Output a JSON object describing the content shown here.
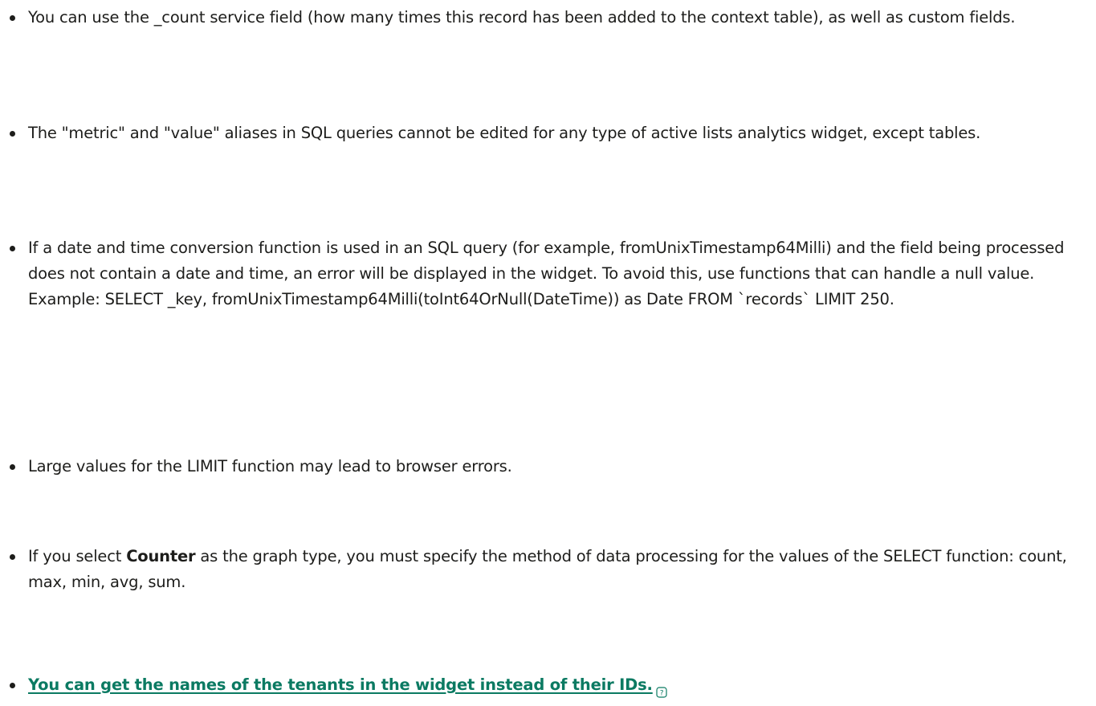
{
  "bullets": {
    "b1": "You can use the _count service field (how many times this record has been added to the context table), as well as custom fields.",
    "b2": "The \"metric\" and \"value\" aliases in SQL queries cannot be edited for any type of active lists analytics widget, except tables.",
    "b3": "If a date and time conversion function is used in an SQL query (for example, fromUnixTimestamp64Milli) and the field being processed does not contain a date and time, an error will be displayed in the widget. To avoid this, use functions that can handle a null value. Example: SELECT _key, fromUnixTimestamp64Milli(toInt64OrNull(DateTime)) as Date FROM `records` LIMIT 250.",
    "b4": "Large values for the LIMIT function may lead to browser errors.",
    "b5_pre": "If you select ",
    "b5_bold": "Counter",
    "b5_post": " as the graph type, you must specify the method of data processing for the values of the SELECT function: count, max, min, avg, sum.",
    "b6_link": "You can get the names of the tenants in the widget instead of their IDs."
  },
  "icons": {
    "help": "question-mark-box-icon"
  },
  "colors": {
    "text": "#1d1d1b",
    "link": "#0b7a62"
  }
}
